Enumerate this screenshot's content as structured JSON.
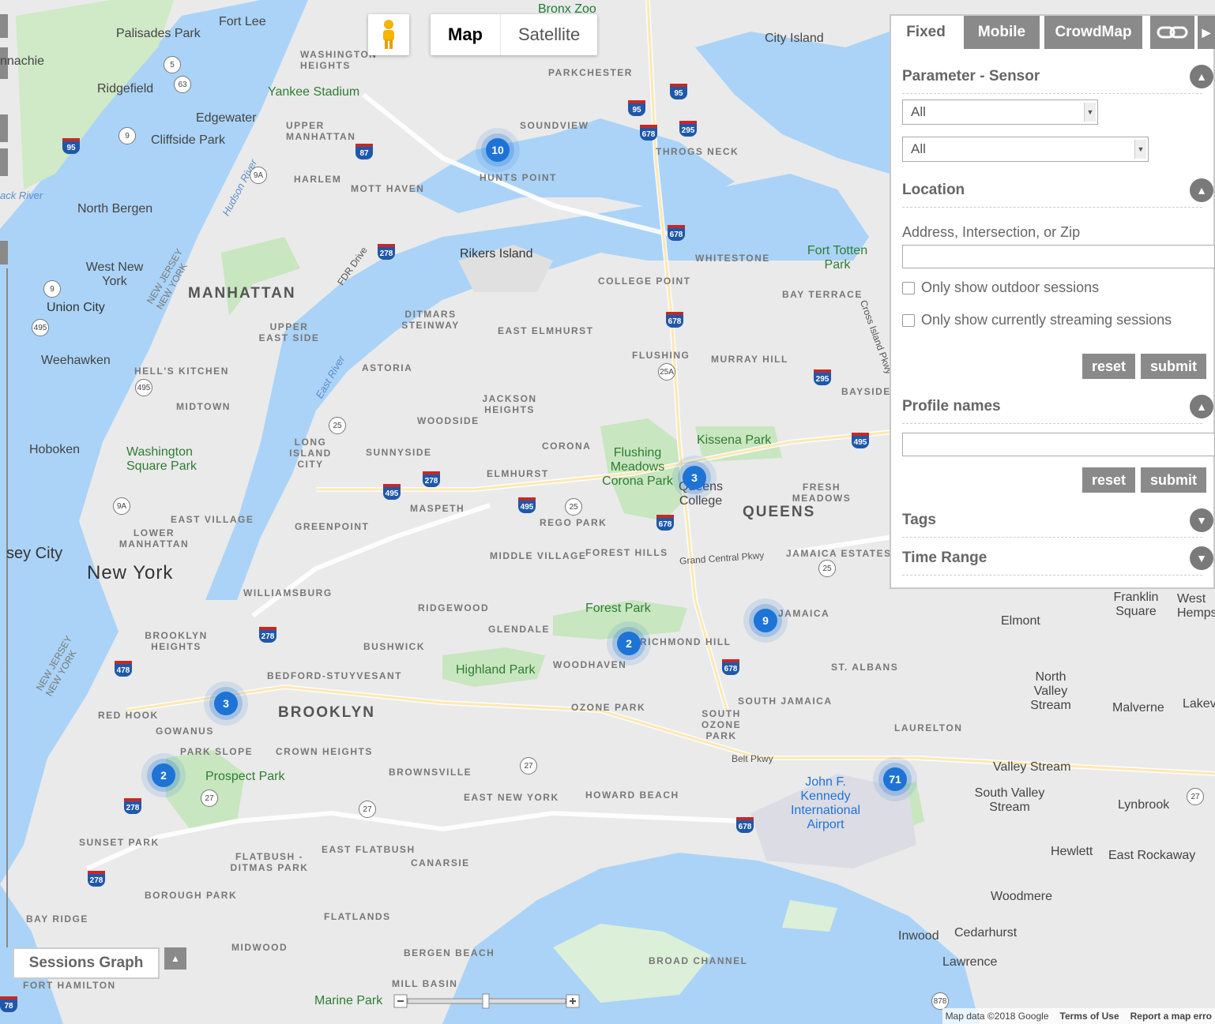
{
  "map_type": {
    "map": "Map",
    "satellite": "Satellite"
  },
  "panel": {
    "tabs": [
      "Fixed",
      "Mobile",
      "CrowdMap"
    ],
    "sections": {
      "parameter": "Parameter - Sensor",
      "location": "Location",
      "profiles": "Profile names",
      "tags": "Tags",
      "time_range": "Time Range"
    },
    "selects": [
      "All",
      "All"
    ],
    "location_label": "Address, Intersection, or Zip",
    "outdoor": "Only show outdoor sessions",
    "streaming": "Only show currently streaming sessions",
    "reset": "reset",
    "submit": "submit"
  },
  "sessions_graph": "Sessions Graph",
  "clusters": [
    "10",
    "3",
    "9",
    "2",
    "3",
    "2",
    "71"
  ],
  "attribution": {
    "data": "Map data ©2018 Google",
    "terms": "Terms of Use",
    "report": "Report a map erro"
  },
  "labels": {
    "bronx_zoo": "Bronx Zoo",
    "fort_lee": "Fort Lee",
    "palisades": "Palisades Park",
    "city_island": "City Island",
    "ridgefield": "Ridgefield",
    "edgewater": "Edgewater",
    "cliffside": "Cliffside Park",
    "yankee": "Yankee Stadium",
    "washington_heights": "WASHINGTON HEIGHTS",
    "parkchester": "PARKCHESTER",
    "soundview": "SOUNDVIEW",
    "upper_manhattan": "UPPER MANHATTAN",
    "throgs_neck": "THROGS NECK",
    "harlem": "HARLEM",
    "mott_haven": "MOTT HAVEN",
    "hunts_point": "HUNTS POINT",
    "north_bergen": "North Bergen",
    "rikers": "Rikers Island",
    "whitestone": "WHITESTONE",
    "fort_totten": "Fort Totten Park",
    "west_new_york": "West New York",
    "manhattan": "MANHATTAN",
    "college_point": "COLLEGE POINT",
    "bay_terrace": "BAY TERRACE",
    "union_city": "Union City",
    "upper_east_side": "UPPER EAST SIDE",
    "ditmars": "DITMARS STEINWAY",
    "east_elmhurst": "EAST ELMHURST",
    "weehawken": "Weehawken",
    "hells_kitchen": "HELL'S KITCHEN",
    "astoria": "ASTORIA",
    "flushing": "FLUSHING",
    "murray_hill": "MURRAY HILL",
    "bayside": "BAYSIDE",
    "midtown": "MIDTOWN",
    "jackson_heights": "JACKSON HEIGHTS",
    "woodside": "WOODSIDE",
    "kissena": "Kissena Park",
    "hoboken": "Hoboken",
    "wsp": "Washington Square Park",
    "lic": "LONG ISLAND CITY",
    "sunnyside": "SUNNYSIDE",
    "corona": "CORONA",
    "fmcp": "Flushing Meadows Corona Park",
    "elmhurst": "ELMHURST",
    "queens_college": "Queens College",
    "fresh_meadows": "FRESH MEADOWS",
    "queens": "QUEENS",
    "east_village": "EAST VILLAGE",
    "maspeth": "MASPETH",
    "rego_park": "REGO PARK",
    "greenpoint": "GREENPOINT",
    "les": "LOWER MANHATTAN",
    "jersey_city": "sey City",
    "new_york": "New York",
    "middle_village": "MIDDLE VILLAGE",
    "forest_hills": "FOREST HILLS",
    "gcp": "Grand Central Pkwy",
    "jamaica_estates": "JAMAICA ESTATES",
    "williamsburg": "WILLIAMSBURG",
    "ridgewood": "RIDGEWOOD",
    "forest_park": "Forest Park",
    "jamaica": "JAMAICA",
    "glendale": "GLENDALE",
    "richmond_hill": "RICHMOND HILL",
    "elmont": "Elmont",
    "brooklyn_heights": "BROOKLYN HEIGHTS",
    "bushwick": "BUSHWICK",
    "highland_park": "Highland Park",
    "woodhaven": "WOODHAVEN",
    "st_albans": "ST. ALBANS",
    "north_valley": "North Valley Stream",
    "bed_stuy": "BEDFORD-STUYVESANT",
    "red_hook": "RED HOOK",
    "brooklyn": "BROOKLYN",
    "ozone_park": "OZONE PARK",
    "south_jamaica": "SOUTH JAMAICA",
    "south_ozone": "SOUTH OZONE PARK",
    "malverne": "Malverne",
    "gowanus": "GOWANUS",
    "laurelton": "LAURELTON",
    "park_slope": "PARK SLOPE",
    "crown_heights": "CROWN HEIGHTS",
    "belt_pkwy": "Belt Pkwy",
    "valley_stream": "Valley Stream",
    "prospect": "Prospect Park",
    "brownsville": "BROWNSVILLE",
    "jfk": "John F. Kennedy International Airport",
    "south_valley": "South Valley Stream",
    "lynbrook": "Lynbrook",
    "east_new_york": "EAST NEW YORK",
    "howard_beach": "HOWARD BEACH",
    "sunset_park": "SUNSET PARK",
    "flatbush": "FLATBUSH - DITMAS PARK",
    "east_flatbush": "EAST FLATBUSH",
    "canarsie": "CANARSIE",
    "hewlett": "Hewlett",
    "east_rockaway": "East Rockaway",
    "borough_park": "BOROUGH PARK",
    "woodmere": "Woodmere",
    "bay_ridge": "BAY RIDGE",
    "flatlands": "FLATLANDS",
    "inwood": "Inwood",
    "cedarhurst": "Cedarhurst",
    "midwood": "MIDWOOD",
    "bergen_beach": "BERGEN BEACH",
    "broad_channel": "BROAD CHANNEL",
    "lawrence": "Lawrence",
    "fort_hamilton": "FORT HAMILTON",
    "mill_basin": "MILL BASIN",
    "marine_park": "Marine Park",
    "hudson": "Hudson River",
    "east_river": "East River",
    "nj_ny": "NEW JERSEY NEW YORK",
    "fdr": "FDR Drive",
    "cross_island": "Cross Island Pkwy",
    "franklin_square": "Franklin Square",
    "west_hempstead": "West Hempstead",
    "lakeview": "Lakev",
    "chinachie": "nnachie",
    "hack_river": "ack River"
  }
}
